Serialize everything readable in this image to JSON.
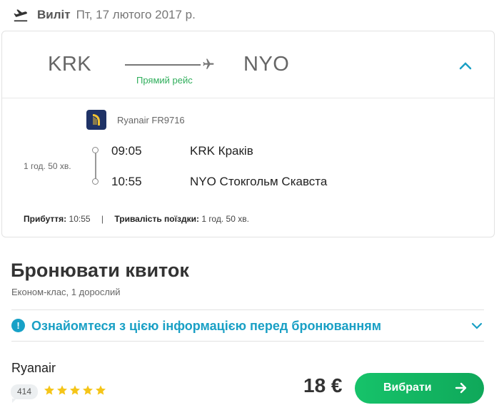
{
  "header": {
    "icon": "departure-plane-icon",
    "direction": "Виліт",
    "date": "Пт, 17 лютого 2017 р."
  },
  "route": {
    "from_code": "KRK",
    "to_code": "NYO",
    "flight_type": "Прямий рейс",
    "collapse_icon": "chevron-up-icon"
  },
  "segment": {
    "airline_logo_icon": "ryanair-harp-icon",
    "airline_flight": "Ryanair FR9716",
    "duration": "1 год. 50 хв.",
    "departure_time": "09:05",
    "departure_place": "KRK Краків",
    "arrival_time": "10:55",
    "arrival_place": "NYO Стокгольм Скавста"
  },
  "summary": {
    "arrival_label": "Прибуття:",
    "arrival_value": "10:55",
    "separator": "|",
    "trip_label": "Тривалість поїздки:",
    "trip_value": "1 год. 50 хв."
  },
  "booking": {
    "title": "Бронювати квиток",
    "subtitle": "Економ-клас, 1 дорослий",
    "info_text": "Ознайомтеся з цією інформацією перед бронюванням",
    "info_icon": "exclamation-circle-icon"
  },
  "offer": {
    "provider": "Ryanair",
    "reviews_count": "414",
    "rating_stars": 5,
    "price": "18 €",
    "select_label": "Вибрати"
  },
  "colors": {
    "accent_green": "#16c36a",
    "accent_teal": "#1aa0c5",
    "star": "#f5c518",
    "direct_green": "#2fae5b"
  }
}
